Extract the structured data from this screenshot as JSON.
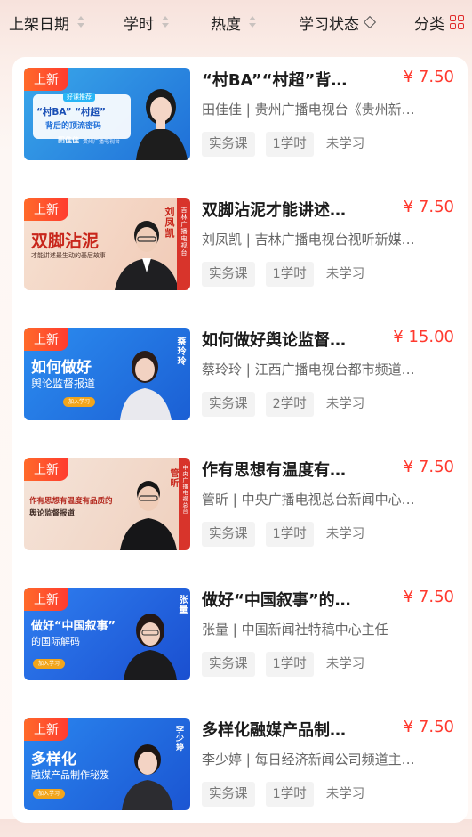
{
  "filters": [
    {
      "label": "上架日期",
      "control": "sort-arrows"
    },
    {
      "label": "学时",
      "control": "sort-arrows"
    },
    {
      "label": "热度",
      "control": "sort-arrows"
    },
    {
      "label": "学习状态",
      "control": "dropdown"
    },
    {
      "label": "分类",
      "control": "grid"
    }
  ],
  "badge_label": "上新",
  "courses": [
    {
      "title": "“村BA”“村超”背…",
      "price": "¥ 7.50",
      "author": "田佳佳 | 贵州广播电视台《贵州新…",
      "type": "实务课",
      "hours": "1学时",
      "status": "未学习",
      "cover": {
        "line1": "“村BA” “村超”",
        "line2": "背后的顶流密码",
        "person": "田佳佳",
        "org": "贵州广播电视台",
        "tag": "好课推荐"
      }
    },
    {
      "title": "双脚沾泥才能讲述…",
      "price": "¥ 7.50",
      "author": "刘凤凯 | 吉林广播电视台视听新媒…",
      "type": "实务课",
      "hours": "1学时",
      "status": "未学习",
      "cover": {
        "line1": "双脚沾泥",
        "line2": "才能讲述最生动的基层故事",
        "person": "刘凤凯",
        "org": "吉林广播电视台"
      }
    },
    {
      "title": "如何做好舆论监督…",
      "price": "¥ 15.00",
      "author": "蔡玲玲 | 江西广播电视台都市频道…",
      "type": "实务课",
      "hours": "2学时",
      "status": "未学习",
      "cover": {
        "line1": "如何做好",
        "line2": "舆论监督报道",
        "person": "蔡玲玲",
        "org": "江西广播电视台",
        "join": "加入学习"
      }
    },
    {
      "title": "作有思想有温度有…",
      "price": "¥ 7.50",
      "author": "管昕 | 中央广播电视总台新闻中心…",
      "type": "实务课",
      "hours": "1学时",
      "status": "未学习",
      "cover": {
        "line1": "作有思想有温度有品质的",
        "line2": "舆论监督报道",
        "person": "管昕",
        "org": "中央广播电视总台"
      }
    },
    {
      "title": "做好“中国叙事”的…",
      "price": "¥ 7.50",
      "author": "张量 | 中国新闻社特稿中心主任",
      "type": "实务课",
      "hours": "1学时",
      "status": "未学习",
      "cover": {
        "line1": "做好“中国叙事”",
        "line2": "的国际解码",
        "person": "张量",
        "org": "中国新闻社",
        "join": "加入学习"
      }
    },
    {
      "title": "多样化融媒产品制…",
      "price": "¥ 7.50",
      "author": "李少婷 | 每日经济新闻公司频道主…",
      "type": "实务课",
      "hours": "1学时",
      "status": "未学习",
      "cover": {
        "line1": "多样化",
        "line2": "融媒产品制作秘笈",
        "person": "李少婷",
        "org": "每日经济新闻",
        "join": "加入学习"
      }
    }
  ],
  "colors": {
    "accent": "#ff3a2f",
    "badge": "#ff5a2a",
    "header_bg": "#f7e2dc"
  }
}
